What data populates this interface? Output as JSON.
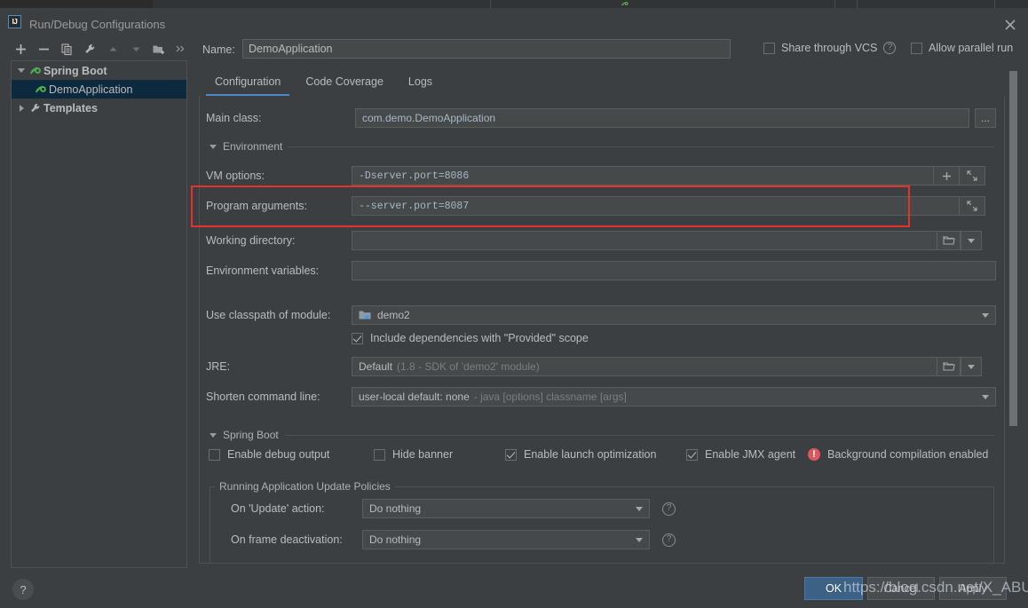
{
  "window": {
    "title": "Run/Debug Configurations",
    "logo_text": "IJ",
    "close_icon": "close-icon"
  },
  "toolbar": {
    "buttons": [
      {
        "name": "add-configuration-button",
        "icon": "plus-icon",
        "tooltip": "Add New Configuration"
      },
      {
        "name": "remove-configuration-button",
        "icon": "minus-icon",
        "tooltip": "Remove Configuration"
      },
      {
        "name": "copy-configuration-button",
        "icon": "copy-icon",
        "tooltip": "Copy Configuration"
      },
      {
        "name": "edit-templates-button",
        "icon": "wrench-icon",
        "tooltip": "Edit Templates"
      },
      {
        "name": "move-up-button",
        "icon": "arrow-up-icon",
        "tooltip": "Move Up"
      },
      {
        "name": "move-down-button",
        "icon": "arrow-down-icon",
        "tooltip": "Move Down"
      },
      {
        "name": "new-folder-button",
        "icon": "folder-add-icon",
        "tooltip": "Create New Folder"
      },
      {
        "name": "more-options-button",
        "icon": "chevron-double-right-icon",
        "tooltip": "More"
      }
    ]
  },
  "tree": {
    "items": [
      {
        "label": "Spring Boot",
        "icon": "spring-boot-icon",
        "expanded": true,
        "level": 0,
        "selected": false,
        "bold": true
      },
      {
        "label": "DemoApplication",
        "icon": "spring-boot-icon",
        "level": 1,
        "selected": true,
        "bold": false
      },
      {
        "label": "Templates",
        "icon": "wrench-icon",
        "expanded": false,
        "level": 0,
        "selected": false,
        "bold": true
      }
    ]
  },
  "header": {
    "name_label": "Name:",
    "name_value": "DemoApplication",
    "share_vcs_label": "Share through VCS",
    "share_vcs_checked": false,
    "share_vcs_help": "?",
    "allow_parallel_label": "Allow parallel run",
    "allow_parallel_checked": false
  },
  "tabs": [
    {
      "label": "Configuration",
      "active": true
    },
    {
      "label": "Code Coverage",
      "active": false
    },
    {
      "label": "Logs",
      "active": false
    }
  ],
  "form": {
    "main_class_label": "Main class:",
    "main_class_value": "com.demo.DemoApplication",
    "main_class_browse": "...",
    "environment_section": "Environment",
    "vm_options_label": "VM options:",
    "vm_options_value": "-Dserver.port=8086",
    "vm_options_expand_icon": "expand-icon",
    "vm_options_add_icon": "plus-icon",
    "program_args_label": "Program arguments:",
    "program_args_value": "--server.port=8087",
    "program_args_expand_icon": "expand-icon",
    "working_dir_label": "Working directory:",
    "working_dir_value": "",
    "working_dir_browse_icon": "folder-icon",
    "working_dir_dropdown_icon": "chevron-down-icon",
    "env_vars_label": "Environment variables:",
    "env_vars_value": "",
    "env_vars_browse_icon": "list-icon",
    "classpath_label": "Use classpath of module:",
    "classpath_value": "demo2",
    "classpath_icon": "module-icon",
    "classpath_dropdown_icon": "chevron-down-icon",
    "include_provided_label": "Include dependencies with \"Provided\" scope",
    "include_provided_checked": true,
    "jre_label": "JRE:",
    "jre_value": "Default",
    "jre_value_hint": "(1.8 - SDK of 'demo2' module)",
    "jre_browse_icon": "folder-icon",
    "jre_dropdown_icon": "chevron-down-icon",
    "shorten_label": "Shorten command line:",
    "shorten_value": "user-local default: none",
    "shorten_value_hint": "- java [options] classname [args]",
    "shorten_dropdown_icon": "chevron-down-icon"
  },
  "spring_boot": {
    "section_title": "Spring Boot",
    "checkboxes": [
      {
        "label": "Enable debug output",
        "checked": false,
        "name": "enable-debug-output-checkbox"
      },
      {
        "label": "Hide banner",
        "checked": false,
        "name": "hide-banner-checkbox"
      },
      {
        "label": "Enable launch optimization",
        "checked": true,
        "name": "enable-launch-optimization-checkbox"
      },
      {
        "label": "Enable JMX agent",
        "checked": true,
        "name": "enable-jmx-agent-checkbox"
      }
    ],
    "warning_icon": "error-icon",
    "warning_text": "Background compilation enabled",
    "update_policies_title": "Running Application Update Policies",
    "on_update_label": "On 'Update' action:",
    "on_update_value": "Do nothing",
    "on_update_help": "?",
    "on_frame_label": "On frame deactivation:",
    "on_frame_value": "Do nothing",
    "on_frame_help": "?"
  },
  "footer": {
    "help_label": "?",
    "ok_label": "OK",
    "cancel_label": "Cancel",
    "apply_label": "Apply",
    "watermark": "https://blog.csdn.net/X_ABU"
  },
  "colors": {
    "accent_blue": "#4a88c7",
    "selection_blue": "#0d293e",
    "error_red": "#db5860",
    "highlight_red": "#e8312a",
    "panel_bg": "#3c3f41",
    "field_bg": "#45494a",
    "text": "#bbbbbb",
    "value_text": "#a9b7c6",
    "primary_button": "#3d6185"
  }
}
